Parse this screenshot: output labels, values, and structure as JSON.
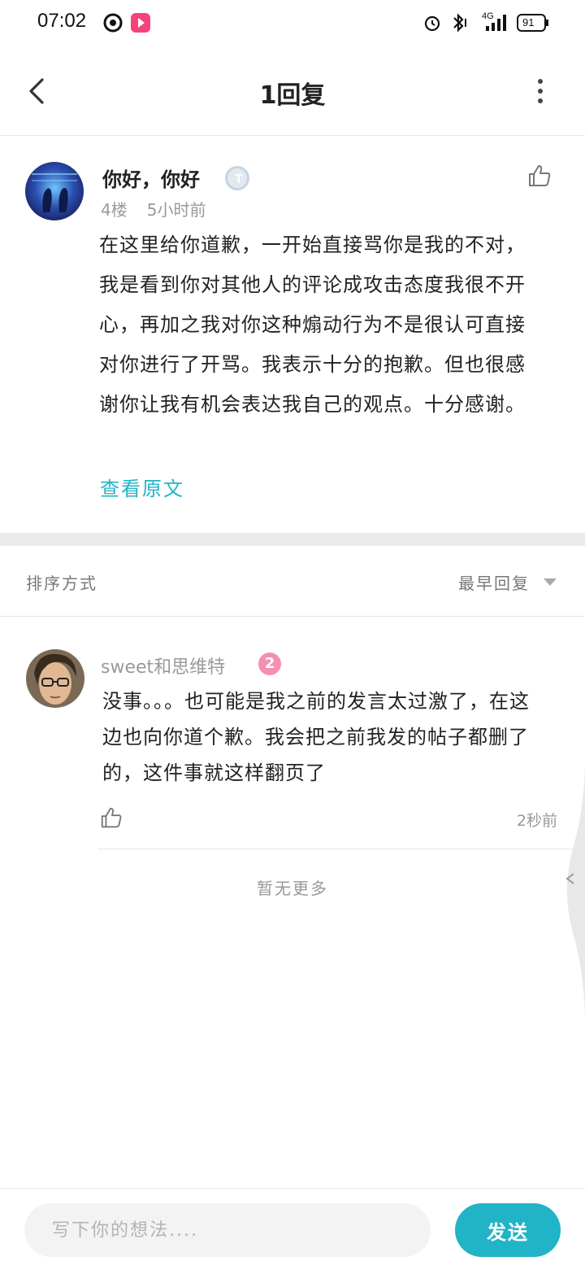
{
  "status": {
    "time": "07:02",
    "network": "4G",
    "battery": "91"
  },
  "appbar": {
    "title": "1回复"
  },
  "post": {
    "username": "你好，你好",
    "floor": "4楼",
    "time": "5小时前",
    "content": "在这里给你道歉，一开始直接骂你是我的不对，我是看到你对其他人的评论成攻击态度我很不开心，再加之我对你这种煽动行为不是很认可直接对你进行了开骂。我表示十分的抱歉。但也很感谢你让我有机会表达我自己的观点。十分感谢。",
    "view_original": "查看原文"
  },
  "sort": {
    "label": "排序方式",
    "value": "最早回复"
  },
  "reply": {
    "username": "sweet和思维特",
    "level": "2",
    "content": "没事。。。也可能是我之前的发言太过激了，在这边也向你道个歉。我会把之前我发的帖子都删了的，这件事就这样翻页了",
    "time": "2秒前"
  },
  "footer_text": "暂无更多",
  "composer": {
    "placeholder": "写下你的想法....",
    "send_label": "发送"
  },
  "colors": {
    "accent": "#21b3c6",
    "divider": "#ebebeb"
  }
}
